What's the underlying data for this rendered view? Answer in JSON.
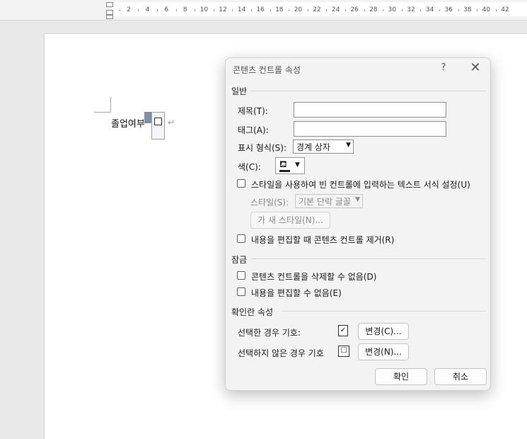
{
  "ruler": {
    "numbers": [
      "2",
      "4",
      "6",
      "8",
      "10",
      "12",
      "14",
      "16",
      "18",
      "20",
      "22",
      "24",
      "26",
      "28",
      "30",
      "32",
      "34",
      "36",
      "38",
      "40",
      "42"
    ]
  },
  "document": {
    "text": "졸업여부",
    "para_mark": "↵"
  },
  "dialog": {
    "title": "콘텐츠 컨트롤 속성",
    "help": "?",
    "close": "✕",
    "general": {
      "heading": "일반",
      "title_label": "제목(T):",
      "title_value": "",
      "tag_label": "태그(A):",
      "tag_value": "",
      "show_as_label": "표시 형식(S):",
      "show_as_value": "경계 상자",
      "color_label": "색(C):",
      "use_style_label": "스타일을 사용하여 빈 컨트롤에 입력하는 텍스트 서식 설정(U)",
      "style_label": "스타일(S):",
      "style_value": "기본 단락 글꼴",
      "new_style_label": "새 스타일(N)...",
      "new_style_icon": "가",
      "remove_label": "내용을 편집할 때 콘텐츠 컨트롤 제거(R)"
    },
    "locking": {
      "heading": "잠금",
      "cannot_delete_label": "콘텐츠 컨트롤을 삭제할 수 없음(D)",
      "cannot_edit_label": "내용을 편집할 수 없음(E)"
    },
    "checkbox_props": {
      "heading": "확인란 속성",
      "checked_label": "선택한 경우 기호:",
      "checked_symbol": "✓",
      "checked_change": "변경(C)...",
      "unchecked_label": "선택하지 않은 경우 기호",
      "unchecked_symbol": "☐",
      "unchecked_change": "변경(N)..."
    },
    "ok": "확인",
    "cancel": "취소"
  }
}
